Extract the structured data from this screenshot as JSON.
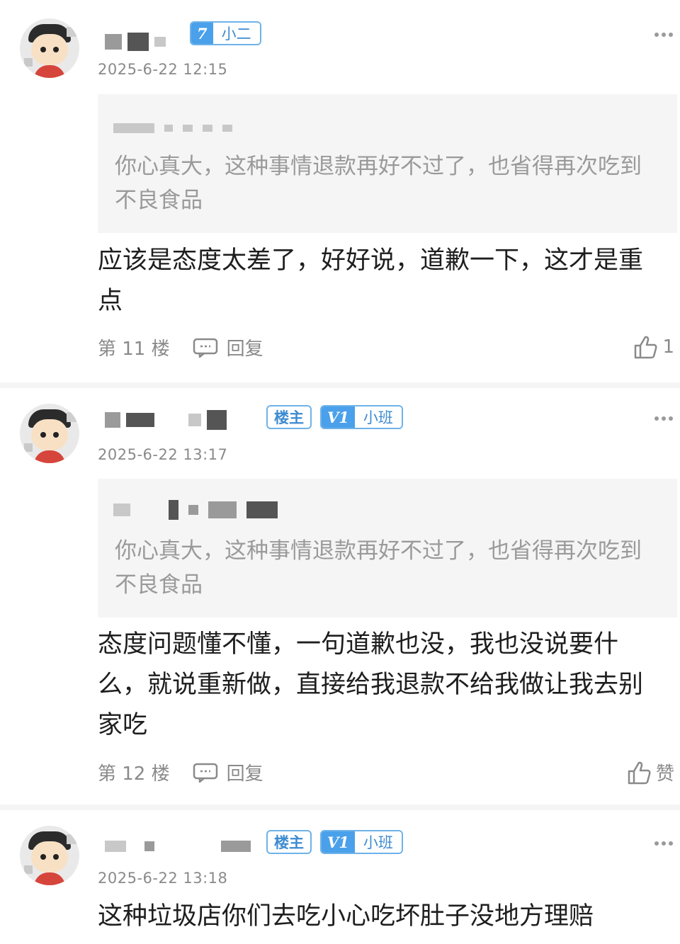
{
  "posts": [
    {
      "level_badge": {
        "level": "7",
        "rank": "小二"
      },
      "timestamp": "2025-6-22 12:15",
      "quote_text": "你心真大，这种事情退款再好不过了，也省得再次吃到不良食品",
      "body": "应该是态度太差了，好好说，道歉一下，这才是重点",
      "floor": "第 11 楼",
      "reply_label": "回复",
      "like_label": "1"
    },
    {
      "owner_badge": "楼主",
      "level_badge": {
        "level": "V1",
        "rank": "小班"
      },
      "timestamp": "2025-6-22 13:17",
      "quote_text": "你心真大，这种事情退款再好不过了，也省得再次吃到不良食品",
      "body": "态度问题懂不懂，一句道歉也没，我也没说要什么，就说重新做，直接给我退款不给我做让我去别家吃",
      "floor": "第 12 楼",
      "reply_label": "回复",
      "like_label": "赞"
    },
    {
      "owner_badge": "楼主",
      "level_badge": {
        "level": "V1",
        "rank": "小班"
      },
      "timestamp": "2025-6-22 13:18",
      "body": "这种垃圾店你们去吃小心吃坏肚子没地方理赔"
    }
  ],
  "colors": {
    "badge_blue": "#4aa0ea",
    "badge_border": "#6fb2e8",
    "meta_gray": "#8a8a8a",
    "quote_bg": "#f5f5f5"
  },
  "icons": [
    "more-icon",
    "reply-icon",
    "like-icon",
    "avatar"
  ]
}
